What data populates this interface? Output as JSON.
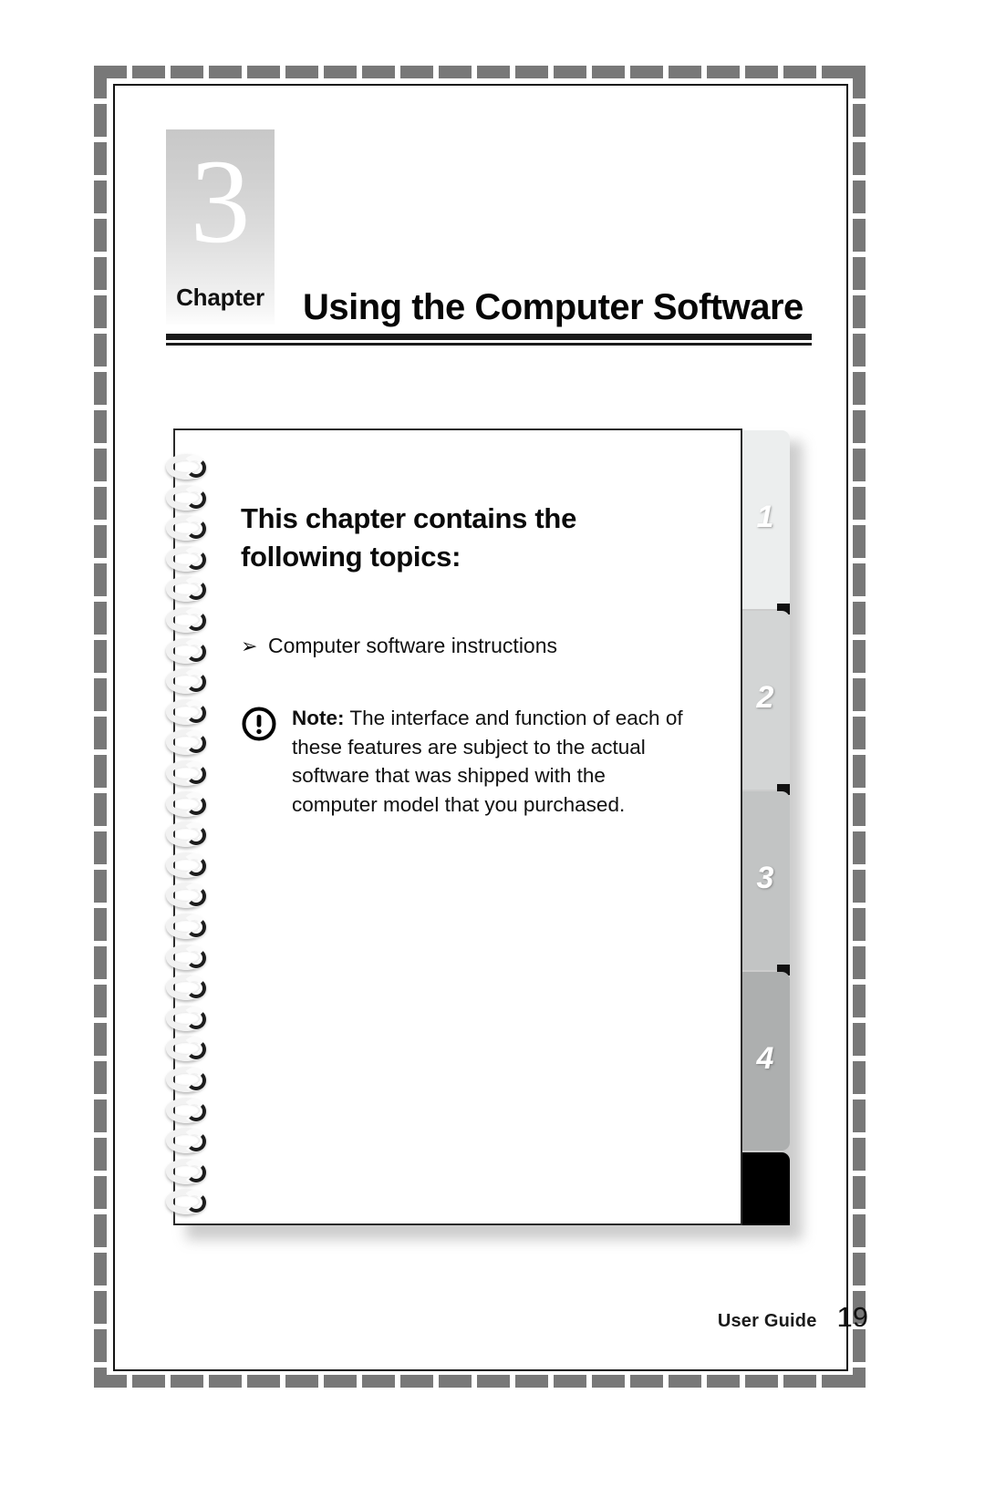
{
  "document": {
    "chapter_word": "Chapter",
    "chapter_number": "3",
    "chapter_title": "Using the Computer Software"
  },
  "notebook": {
    "topics_heading": "This chapter contains the following topics:",
    "bullet_glyph": "➢",
    "bullets": [
      {
        "text": "Computer software instructions"
      }
    ],
    "note": {
      "icon": "exclamation-circle-icon",
      "label": "Note:",
      "text": " The interface and function of each of these features are subject to the actual software that was shipped with the computer model that you purchased."
    },
    "tabs": [
      {
        "number": "1",
        "color": "#eceeee"
      },
      {
        "number": "2",
        "color": "#d3d5d5"
      },
      {
        "number": "3",
        "color": "#c2c4c4"
      },
      {
        "number": "4",
        "color": "#adafaf"
      },
      {
        "number": "",
        "color": "#000000"
      }
    ]
  },
  "footer": {
    "label": "User Guide",
    "page_number": "19"
  },
  "colors": {
    "frame_dash": "#787878",
    "rule_black": "#1a1a1a",
    "badge_gradient_top": "#c8c8c8",
    "badge_gradient_bottom": "#fdfdfd",
    "page_background": "#ffffff"
  }
}
